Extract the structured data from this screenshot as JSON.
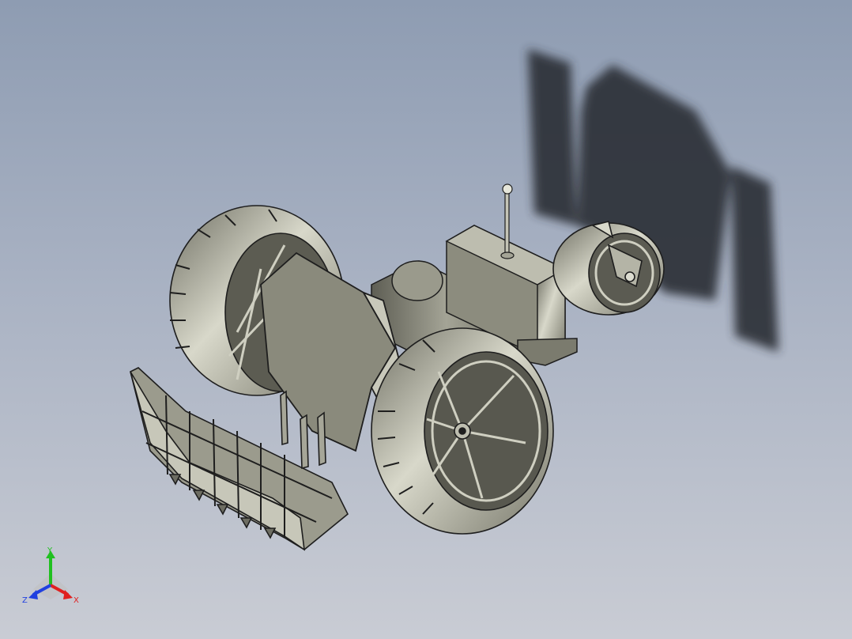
{
  "viewport": {
    "background_top": "#8e9cb2",
    "background_bottom": "#c9ccd4"
  },
  "model": {
    "body_color": "#8c8c7e",
    "highlight_color": "#d8d8ca",
    "edge_color": "#1e1e1e",
    "shadow_color": "#2a2f36"
  },
  "triad": {
    "x_label": "X",
    "y_label": "Y",
    "z_label": "Z",
    "x_color": "#e02020",
    "y_color": "#20c020",
    "z_color": "#2040e0"
  }
}
